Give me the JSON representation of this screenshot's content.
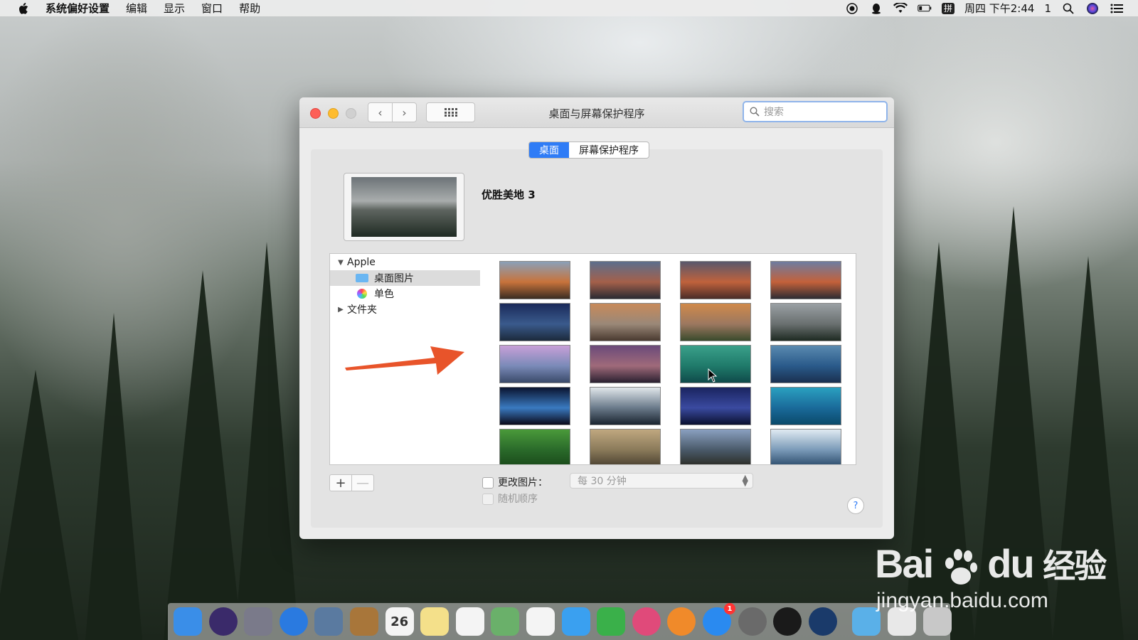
{
  "menubar": {
    "apple_icon": "apple-logo-icon",
    "items": [
      "系统偏好设置",
      "编辑",
      "显示",
      "窗口",
      "帮助"
    ],
    "status": {
      "datetime": "周四 下午2:44",
      "input_method": "拼",
      "count": "1"
    }
  },
  "window": {
    "title": "桌面与屏幕保护程序",
    "search_placeholder": "搜索",
    "tabs": [
      "桌面",
      "屏幕保护程序"
    ],
    "active_tab": "桌面",
    "current_picture_name": "优胜美地 3",
    "sidebar": {
      "group_apple": "Apple",
      "item_desktop_pictures": "桌面图片",
      "item_solid_colors": "单色",
      "group_folders": "文件夹"
    },
    "add_button": "+",
    "remove_button": "—",
    "change_picture_label": "更改图片：",
    "change_interval": "每 30 分钟",
    "random_order_label": "随机顺序",
    "help_label": "?"
  },
  "thumbnails": [
    {
      "name": "sierra-1",
      "colors": [
        "#8aa0b8",
        "#c8733b",
        "#3a2c22"
      ]
    },
    {
      "name": "sierra-2",
      "colors": [
        "#5c6e8c",
        "#a4604a",
        "#2a2a33"
      ]
    },
    {
      "name": "sierra-3",
      "colors": [
        "#59586c",
        "#c0623c",
        "#4a2c28"
      ]
    },
    {
      "name": "el-capitan",
      "colors": [
        "#6e7ca0",
        "#c3613a",
        "#2d2c33"
      ]
    },
    {
      "name": "yosemite-night",
      "colors": [
        "#1a2a5a",
        "#3a5a8c",
        "#1c2a3c"
      ]
    },
    {
      "name": "half-dome-1",
      "colors": [
        "#c88a5a",
        "#9a8878",
        "#4a3a30"
      ]
    },
    {
      "name": "half-dome-2",
      "colors": [
        "#d08a4a",
        "#9c7860",
        "#3a4a2c"
      ]
    },
    {
      "name": "yosemite-3",
      "colors": [
        "#9aa0a4",
        "#6a7070",
        "#1e2a22"
      ]
    },
    {
      "name": "yosemite-pink",
      "colors": [
        "#c8a0d8",
        "#7a8ab8",
        "#3a4a6a"
      ]
    },
    {
      "name": "lake-dusk",
      "colors": [
        "#6a4a7a",
        "#a06a7a",
        "#2a2030"
      ]
    },
    {
      "name": "wave-green",
      "colors": [
        "#3aa08a",
        "#1f7a6a",
        "#0f4a4a"
      ]
    },
    {
      "name": "wave-blue",
      "colors": [
        "#5a8ab0",
        "#2a5a8a",
        "#1a3050"
      ]
    },
    {
      "name": "earth-night",
      "colors": [
        "#0a1430",
        "#3a7ac0",
        "#0a0a1a"
      ]
    },
    {
      "name": "earth-orbit",
      "colors": [
        "#e0e6ea",
        "#6a7a8a",
        "#1a2430"
      ]
    },
    {
      "name": "galaxy",
      "colors": [
        "#1a2460",
        "#3a4aa0",
        "#0a1030"
      ]
    },
    {
      "name": "water-aerial",
      "colors": [
        "#2aa0c0",
        "#1a6a9a",
        "#0a4a6a"
      ]
    },
    {
      "name": "green-fields",
      "colors": [
        "#4a9a3a",
        "#2a6a2a",
        "#1a4a1a"
      ]
    },
    {
      "name": "foggy-valley",
      "colors": [
        "#c0a880",
        "#8a7a5a",
        "#4a4030"
      ]
    },
    {
      "name": "mountain-haze",
      "colors": [
        "#8aa0c0",
        "#4a5a6a",
        "#2a2a22"
      ]
    },
    {
      "name": "ice-river",
      "colors": [
        "#e0eaf2",
        "#7a9ab8",
        "#2a4a6a"
      ]
    }
  ],
  "dock": [
    {
      "name": "finder-icon",
      "color": "#3a8ee8"
    },
    {
      "name": "siri-icon",
      "color": "#3a2a6a"
    },
    {
      "name": "launchpad-icon",
      "color": "#7a7a8a"
    },
    {
      "name": "safari-icon",
      "color": "#2a7ae0"
    },
    {
      "name": "mail-icon",
      "color": "#5a7aa0"
    },
    {
      "name": "contacts-icon",
      "color": "#a8763a"
    },
    {
      "name": "calendar-icon",
      "color": "#f4f4f4",
      "text": "26"
    },
    {
      "name": "notes-icon",
      "color": "#f4e08a"
    },
    {
      "name": "reminders-icon",
      "color": "#f4f4f4"
    },
    {
      "name": "maps-icon",
      "color": "#6ab06a"
    },
    {
      "name": "photos-icon",
      "color": "#f4f4f4"
    },
    {
      "name": "messages-icon",
      "color": "#3aa0f0"
    },
    {
      "name": "facetime-icon",
      "color": "#3ab04a"
    },
    {
      "name": "itunes-icon",
      "color": "#e04a7a"
    },
    {
      "name": "ibooks-icon",
      "color": "#f08a2a"
    },
    {
      "name": "app-store-icon",
      "color": "#2a8af0",
      "badge": "1"
    },
    {
      "name": "system-preferences-icon",
      "color": "#6a6a6a"
    },
    {
      "name": "qq-icon",
      "color": "#1a1a1a"
    },
    {
      "name": "quicktime-icon",
      "color": "#1a3a6a"
    },
    {
      "name": "downloads-folder-icon",
      "color": "#5ab0e8"
    },
    {
      "name": "preview-icon",
      "color": "#e8e8e8"
    },
    {
      "name": "trash-icon",
      "color": "#c8c8c8"
    }
  ],
  "watermark": {
    "brand": "Bai",
    "brand2": "du",
    "suffix": "经验",
    "url": "jingyan.baidu.com"
  }
}
